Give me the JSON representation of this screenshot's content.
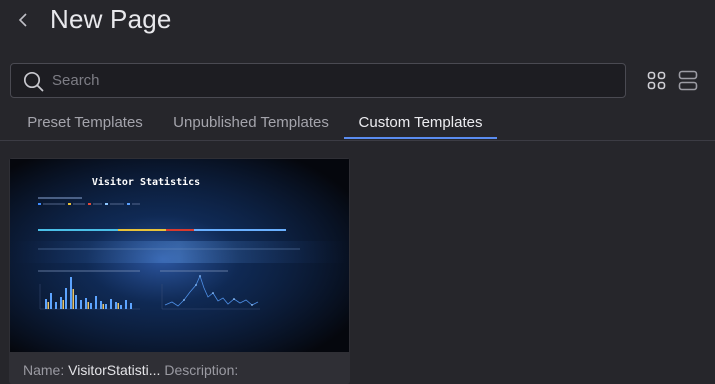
{
  "header": {
    "back_icon": "chevron-left-icon",
    "title": "New Page"
  },
  "search": {
    "placeholder": "Search",
    "value": "",
    "icon": "search-icon"
  },
  "view_toggle": {
    "grid_icon": "grid-view-icon",
    "list_icon": "list-view-icon"
  },
  "tabs": [
    {
      "label": "Preset Templates",
      "active": false
    },
    {
      "label": "Unpublished Templates",
      "active": false
    },
    {
      "label": "Custom Templates",
      "active": true
    }
  ],
  "colors": {
    "background": "#26262b",
    "accent": "#5a8cf0",
    "card": "#2f2f35"
  },
  "templates": [
    {
      "preview_title": "Visitor Statistics",
      "name_label": "Name:",
      "name": "VisitorStatisti...",
      "description_label": "Description:",
      "description": ""
    }
  ]
}
